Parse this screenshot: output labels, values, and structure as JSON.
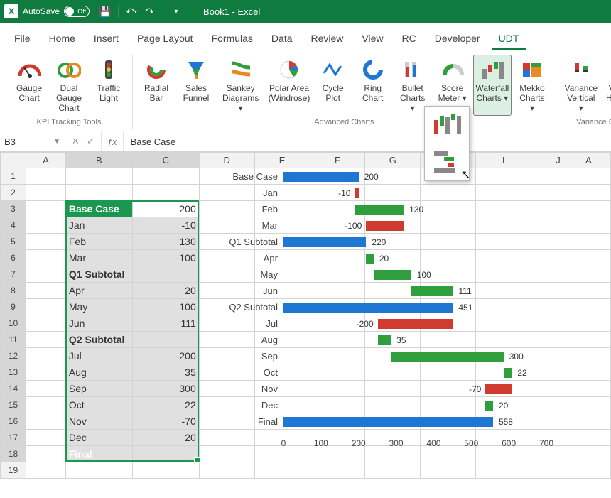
{
  "titlebar": {
    "app_abbr": "X",
    "autosave_label": "AutoSave",
    "toggle_text": "Off",
    "document": "Book1 - Excel"
  },
  "tabs": [
    "File",
    "Home",
    "Insert",
    "Page Layout",
    "Formulas",
    "Data",
    "Review",
    "View",
    "RC",
    "Developer",
    "UDT"
  ],
  "active_tab_index": 10,
  "ribbon": {
    "groups": [
      {
        "label": "KPI Tracking Tools",
        "items": [
          {
            "icon": "gauge",
            "l1": "Gauge",
            "l2": "Chart"
          },
          {
            "icon": "dual-gauge",
            "l1": "Dual Gauge",
            "l2": "Chart"
          },
          {
            "icon": "traffic",
            "l1": "Traffic",
            "l2": "Light"
          }
        ]
      },
      {
        "label": "Advanced Charts",
        "items": [
          {
            "icon": "radial",
            "l1": "Radial",
            "l2": "Bar"
          },
          {
            "icon": "funnel",
            "l1": "Sales",
            "l2": "Funnel"
          },
          {
            "icon": "sankey",
            "l1": "Sankey",
            "l2": "Diagrams ▾"
          },
          {
            "icon": "polar",
            "l1": "Polar Area",
            "l2": "(Windrose)"
          },
          {
            "icon": "cycle",
            "l1": "Cycle",
            "l2": "Plot"
          },
          {
            "icon": "ring",
            "l1": "Ring",
            "l2": "Chart"
          },
          {
            "icon": "bullet",
            "l1": "Bullet",
            "l2": "Charts ▾"
          },
          {
            "icon": "score",
            "l1": "Score",
            "l2": "Meter ▾"
          },
          {
            "icon": "waterfall",
            "l1": "Waterfall",
            "l2": "Charts ▾",
            "active": true
          },
          {
            "icon": "mekko",
            "l1": "Mekko",
            "l2": "Charts ▾"
          }
        ]
      },
      {
        "label": "Variance Charts",
        "items": [
          {
            "icon": "var-v",
            "l1": "Variance",
            "l2": "Vertical ▾"
          },
          {
            "icon": "var-h",
            "l1": "Variance",
            "l2": "Horizontal"
          }
        ]
      }
    ]
  },
  "namebox": "B3",
  "formula_value": "Base Case",
  "columns": [
    "A",
    "B",
    "C",
    "D",
    "E",
    "F",
    "G",
    "H",
    "I",
    "J"
  ],
  "last_col_glyph": "A",
  "data_rows": [
    {
      "r": 3,
      "label": "Base Case",
      "value": 200,
      "total": true,
      "first": true
    },
    {
      "r": 4,
      "label": "Jan",
      "value": -10
    },
    {
      "r": 5,
      "label": "Feb",
      "value": 130
    },
    {
      "r": 6,
      "label": "Mar",
      "value": -100
    },
    {
      "r": 7,
      "label": "Q1 Subtotal",
      "value": null,
      "subtotal": true
    },
    {
      "r": 8,
      "label": "Apr",
      "value": 20
    },
    {
      "r": 9,
      "label": "May",
      "value": 100
    },
    {
      "r": 10,
      "label": "Jun",
      "value": 111
    },
    {
      "r": 11,
      "label": "Q2 Subtotal",
      "value": null,
      "subtotal": true
    },
    {
      "r": 12,
      "label": "Jul",
      "value": -200
    },
    {
      "r": 13,
      "label": "Aug",
      "value": 35
    },
    {
      "r": 14,
      "label": "Sep",
      "value": 300
    },
    {
      "r": 15,
      "label": "Oct",
      "value": 22
    },
    {
      "r": 16,
      "label": "Nov",
      "value": -70
    },
    {
      "r": 17,
      "label": "Dec",
      "value": 20
    },
    {
      "r": 18,
      "label": "Final",
      "value": null,
      "total": true
    }
  ],
  "chart_data": {
    "type": "bar",
    "orientation": "horizontal",
    "title": "",
    "xlabel": "",
    "ylabel": "",
    "xlim": [
      0,
      700
    ],
    "ticks": [
      0,
      100,
      200,
      300,
      400,
      500,
      600,
      700
    ],
    "series": [
      {
        "category": "Base Case",
        "kind": "total",
        "start": 0,
        "end": 200,
        "value": 200
      },
      {
        "category": "Jan",
        "kind": "neg",
        "start": 190,
        "end": 200,
        "value": -10
      },
      {
        "category": "Feb",
        "kind": "pos",
        "start": 190,
        "end": 320,
        "value": 130
      },
      {
        "category": "Mar",
        "kind": "neg",
        "start": 220,
        "end": 320,
        "value": -100
      },
      {
        "category": "Q1 Subtotal",
        "kind": "total",
        "start": 0,
        "end": 220,
        "value": 220
      },
      {
        "category": "Apr",
        "kind": "pos",
        "start": 220,
        "end": 240,
        "value": 20
      },
      {
        "category": "May",
        "kind": "pos",
        "start": 240,
        "end": 340,
        "value": 100
      },
      {
        "category": "Jun",
        "kind": "pos",
        "start": 340,
        "end": 451,
        "value": 111
      },
      {
        "category": "Q2 Subtotal",
        "kind": "total",
        "start": 0,
        "end": 451,
        "value": 451
      },
      {
        "category": "Jul",
        "kind": "neg",
        "start": 251,
        "end": 451,
        "value": -200
      },
      {
        "category": "Aug",
        "kind": "pos",
        "start": 251,
        "end": 286,
        "value": 35
      },
      {
        "category": "Sep",
        "kind": "pos",
        "start": 286,
        "end": 586,
        "value": 300
      },
      {
        "category": "Oct",
        "kind": "pos",
        "start": 586,
        "end": 608,
        "value": 22
      },
      {
        "category": "Nov",
        "kind": "neg",
        "start": 538,
        "end": 608,
        "value": -70
      },
      {
        "category": "Dec",
        "kind": "pos",
        "start": 538,
        "end": 558,
        "value": 20
      },
      {
        "category": "Final",
        "kind": "total",
        "start": 0,
        "end": 558,
        "value": 558
      }
    ]
  }
}
